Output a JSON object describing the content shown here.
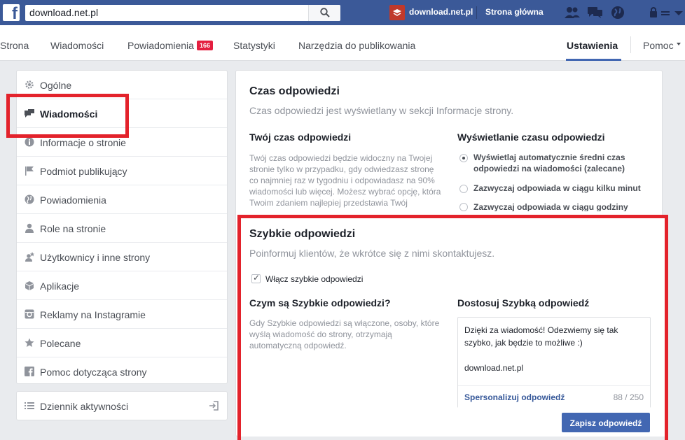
{
  "topbar": {
    "search_value": "download.net.pl",
    "page_name": "download.net.pl",
    "home_label": "Strona główna"
  },
  "nav": {
    "items": [
      "Strona",
      "Wiadomości",
      "Powiadomienia",
      "Statystyki",
      "Narzędzia do publikowania"
    ],
    "notifications_count": "166",
    "active": "Ustawienia",
    "help": "Pomoc"
  },
  "sidebar": {
    "items": [
      {
        "label": "Ogólne",
        "icon": "gear-icon"
      },
      {
        "label": "Wiadomości",
        "icon": "messages-icon"
      },
      {
        "label": "Informacje o stronie",
        "icon": "info-icon"
      },
      {
        "label": "Podmiot publikujący",
        "icon": "flag-icon"
      },
      {
        "label": "Powiadomienia",
        "icon": "globe-icon"
      },
      {
        "label": "Role na stronie",
        "icon": "person-icon"
      },
      {
        "label": "Użytkownicy i inne strony",
        "icon": "person-star-icon"
      },
      {
        "label": "Aplikacje",
        "icon": "cube-icon"
      },
      {
        "label": "Reklamy na Instagramie",
        "icon": "instagram-icon"
      },
      {
        "label": "Polecane",
        "icon": "star-icon"
      },
      {
        "label": "Pomoc dotycząca strony",
        "icon": "facebook-icon"
      }
    ],
    "activity_log": "Dziennik aktywności"
  },
  "response_time": {
    "title": "Czas odpowiedzi",
    "description": "Czas odpowiedzi jest wyświetlany w sekcji Informacje strony.",
    "your_time_title": "Twój czas odpowiedzi",
    "your_time_text": "Twój czas odpowiedzi będzie widoczny na Twojej stronie tylko w przypadku, gdy odwiedzasz stronę co najmniej raz w tygodniu i odpowiadasz na 90% wiadomości lub więcej. Możesz wybrać opcję, która Twoim zdaniem najlepiej przedstawia Twój",
    "display_title": "Wyświetlanie czasu odpowiedzi",
    "options": [
      "Wyświetlaj automatycznie średni czas odpowiedzi na wiadomości (zalecane)",
      "Zazwyczaj odpowiada w ciągu kilku minut",
      "Zazwyczaj odpowiada w ciągu godziny"
    ]
  },
  "instant_replies": {
    "title": "Szybkie odpowiedzi",
    "description": "Poinformuj klientów, że wkrótce się z nimi skontaktujesz.",
    "enable_label": "Włącz szybkie odpowiedzi",
    "what_title": "Czym są Szybkie odpowiedzi?",
    "what_text": "Gdy Szybkie odpowiedzi są włączone, osoby, które wyślą wiadomość do strony, otrzymają automatyczną odpowiedź.",
    "customize_title": "Dostosuj Szybką odpowiedź",
    "message": "Dzięki za wiadomość! Odezwiemy się tak szybko, jak będzie to możliwe :)\n\ndownload.net.pl",
    "personalize_link": "Spersonalizuj odpowiedź",
    "char_count": "88 / 250",
    "save_label": "Zapisz odpowiedź"
  },
  "colors": {
    "facebook_blue": "#3b5998",
    "button_blue": "#4267b2",
    "highlight_red": "#e3222b"
  }
}
